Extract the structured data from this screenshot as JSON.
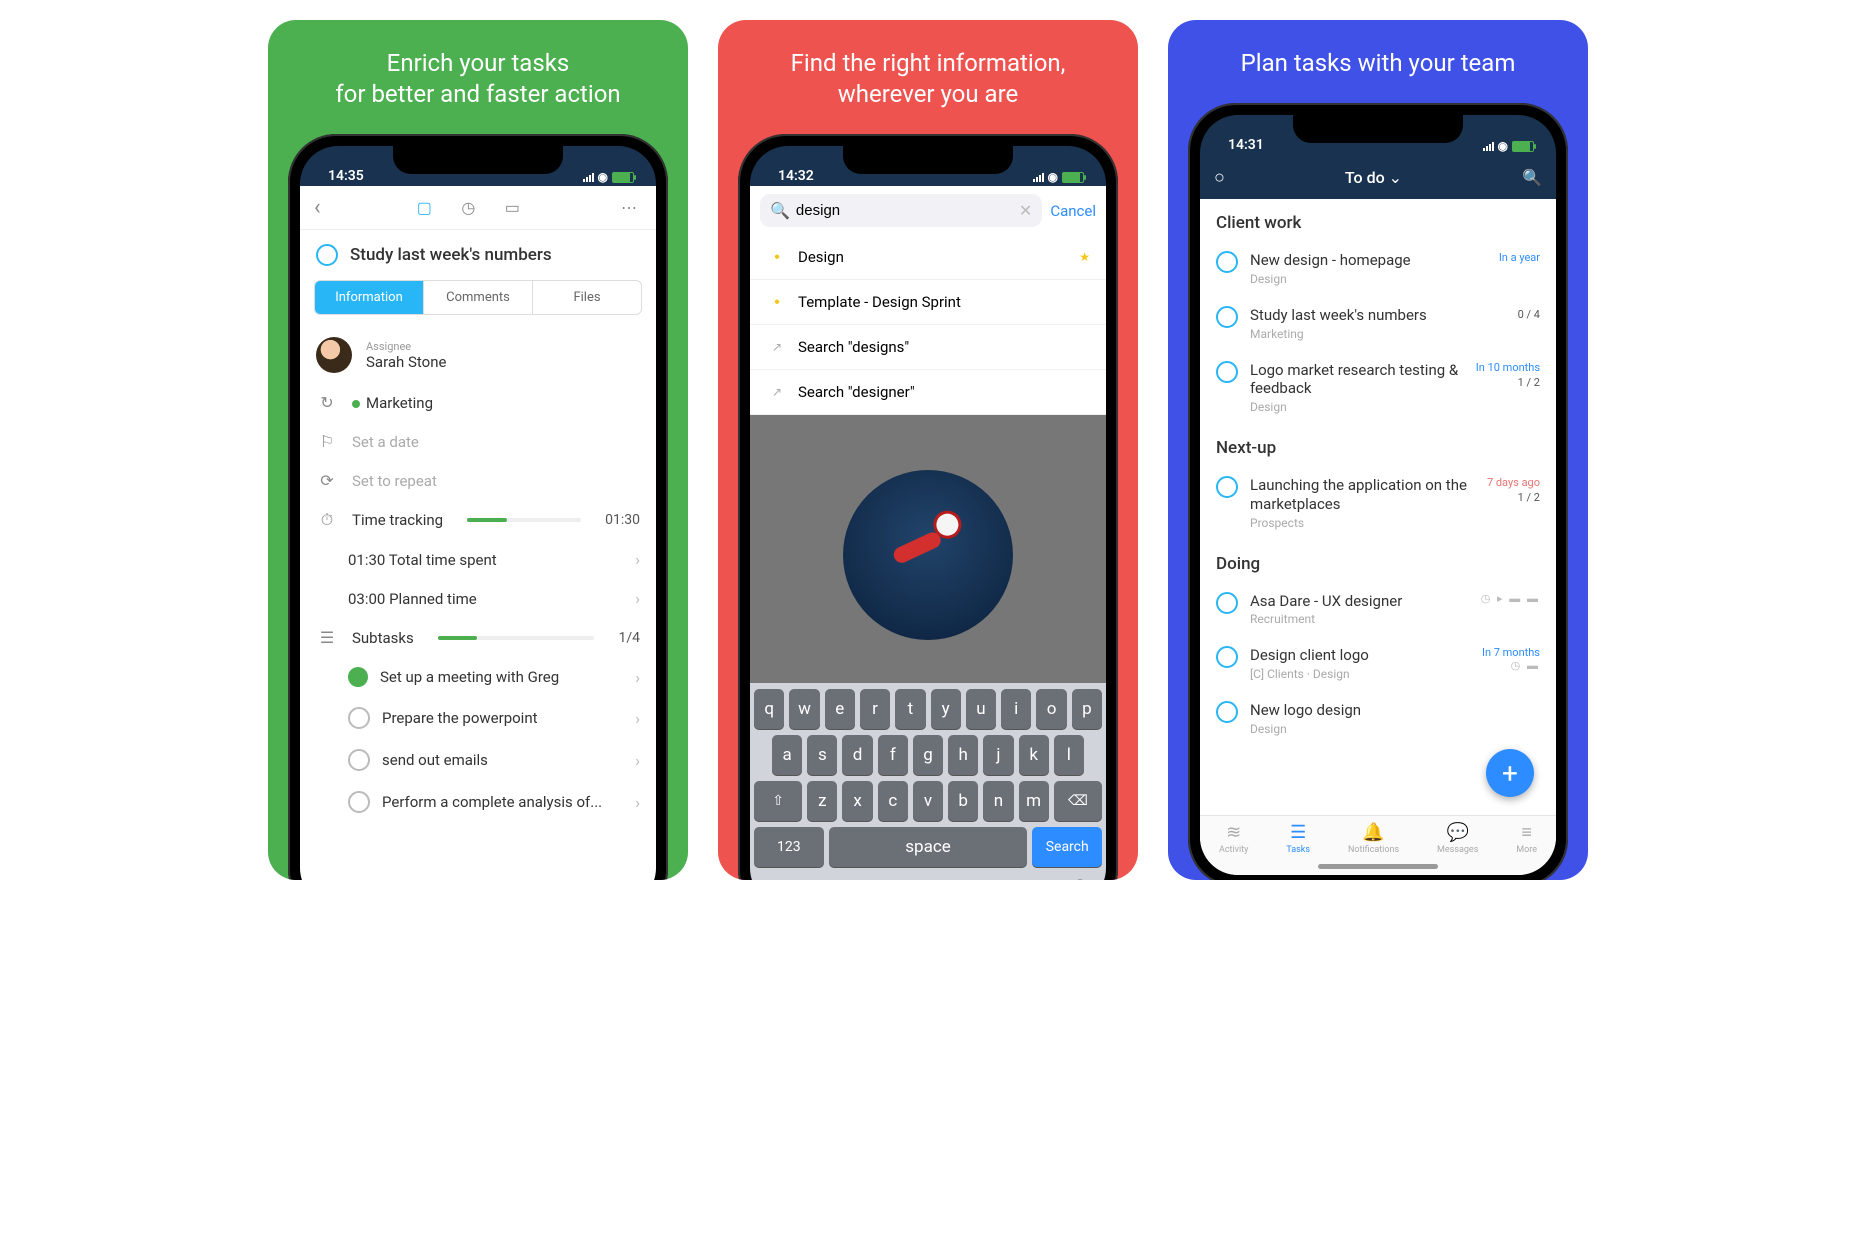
{
  "panels": {
    "p1": {
      "headline": "Enrich your tasks\nfor better and faster action"
    },
    "p2": {
      "headline": "Find the right information,\nwherever you are"
    },
    "p3": {
      "headline": "Plan tasks with your team"
    }
  },
  "status": {
    "t1": "14:35",
    "t2": "14:32",
    "t3": "14:31"
  },
  "screen1": {
    "task_title": "Study last week's numbers",
    "tabs": {
      "info": "Information",
      "comments": "Comments",
      "files": "Files"
    },
    "assignee_label": "Assignee",
    "assignee_name": "Sarah Stone",
    "project": "Marketing",
    "set_date": "Set a date",
    "set_repeat": "Set to repeat",
    "time_tracking_label": "Time tracking",
    "time_tracking_value": "01:30",
    "total_time": "01:30 Total time spent",
    "planned_time": "03:00 Planned time",
    "subtasks_label": "Subtasks",
    "subtasks_count": "1/4",
    "sub1": "Set up a meeting with Greg",
    "sub2": "Prepare the powerpoint",
    "sub3": "send out emails",
    "sub4": "Perform a complete analysis of..."
  },
  "screen2": {
    "query": "design",
    "cancel": "Cancel",
    "r1": "Design",
    "r2": "Template - Design Sprint",
    "r3": "Search \"designs\"",
    "r4": "Search \"designer\"",
    "keys_row1": [
      "q",
      "w",
      "e",
      "r",
      "t",
      "y",
      "u",
      "i",
      "o",
      "p"
    ],
    "keys_row2": [
      "a",
      "s",
      "d",
      "f",
      "g",
      "h",
      "j",
      "k",
      "l"
    ],
    "keys_row3": [
      "z",
      "x",
      "c",
      "v",
      "b",
      "n",
      "m"
    ],
    "key_123": "123",
    "key_space": "space",
    "key_search": "Search"
  },
  "screen3": {
    "header_title": "To do",
    "sections": {
      "s1": "Client work",
      "s2": "Next-up",
      "s3": "Doing"
    },
    "t1": {
      "name": "New design - homepage",
      "sub": "Design",
      "meta": "In a year"
    },
    "t2": {
      "name": "Study last week's numbers",
      "sub": "Marketing",
      "count": "0 / 4"
    },
    "t3": {
      "name": "Logo market research testing & feedback",
      "sub": "Design",
      "meta": "In 10 months",
      "count": "1 / 2"
    },
    "t4": {
      "name": "Launching the application on the marketplaces",
      "sub": "Prospects",
      "meta": "7 days ago",
      "count": "1 / 2"
    },
    "t5": {
      "name": "Asa Dare - UX designer",
      "sub": "Recruitment"
    },
    "t6": {
      "name": "Design client logo",
      "sub": "[C] Clients · Design",
      "meta": "In 7 months"
    },
    "t7": {
      "name": "New logo design",
      "sub": "Design"
    },
    "tabs": {
      "activity": "Activity",
      "tasks": "Tasks",
      "notif": "Notifications",
      "msg": "Messages",
      "more": "More"
    }
  }
}
